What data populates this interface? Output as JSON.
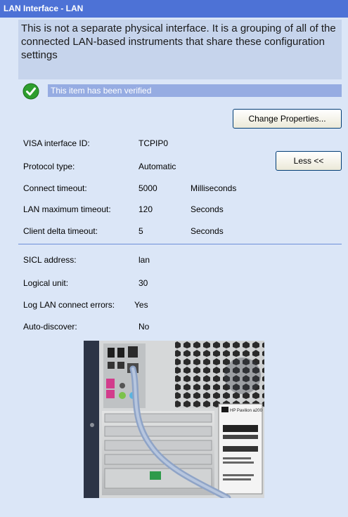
{
  "title": "LAN Interface - LAN",
  "description": "This is not a separate physical interface. It is a grouping of all of the connected LAN-based instruments that share these configuration settings",
  "verified_text": "This item has been verified",
  "buttons": {
    "change_properties": "Change Properties...",
    "less": "Less <<"
  },
  "settings": [
    {
      "label": "VISA interface ID:",
      "value": "TCPIP0",
      "unit": ""
    },
    {
      "label": "Protocol type:",
      "value": "Automatic",
      "unit": ""
    },
    {
      "label": "Connect timeout:",
      "value": "5000",
      "unit": "Milliseconds"
    },
    {
      "label": "LAN maximum timeout:",
      "value": "120",
      "unit": "Seconds"
    },
    {
      "label": "Client delta timeout:",
      "value": "5",
      "unit": "Seconds"
    }
  ],
  "advanced": [
    {
      "label": "SICL address:",
      "value": "lan"
    },
    {
      "label": "Logical unit:",
      "value": "30"
    },
    {
      "label": "Log LAN connect errors:",
      "value": "Yes"
    },
    {
      "label": "Auto-discover:",
      "value": "No"
    }
  ],
  "photo_label": "HP Pavilion a200",
  "colors": {
    "title_bg": "#4d72d6",
    "panel_bg": "#dbe6f7",
    "description_bg": "#c6d4ec",
    "verified_bg": "#96ace2",
    "check_green": "#2e9e2e"
  }
}
